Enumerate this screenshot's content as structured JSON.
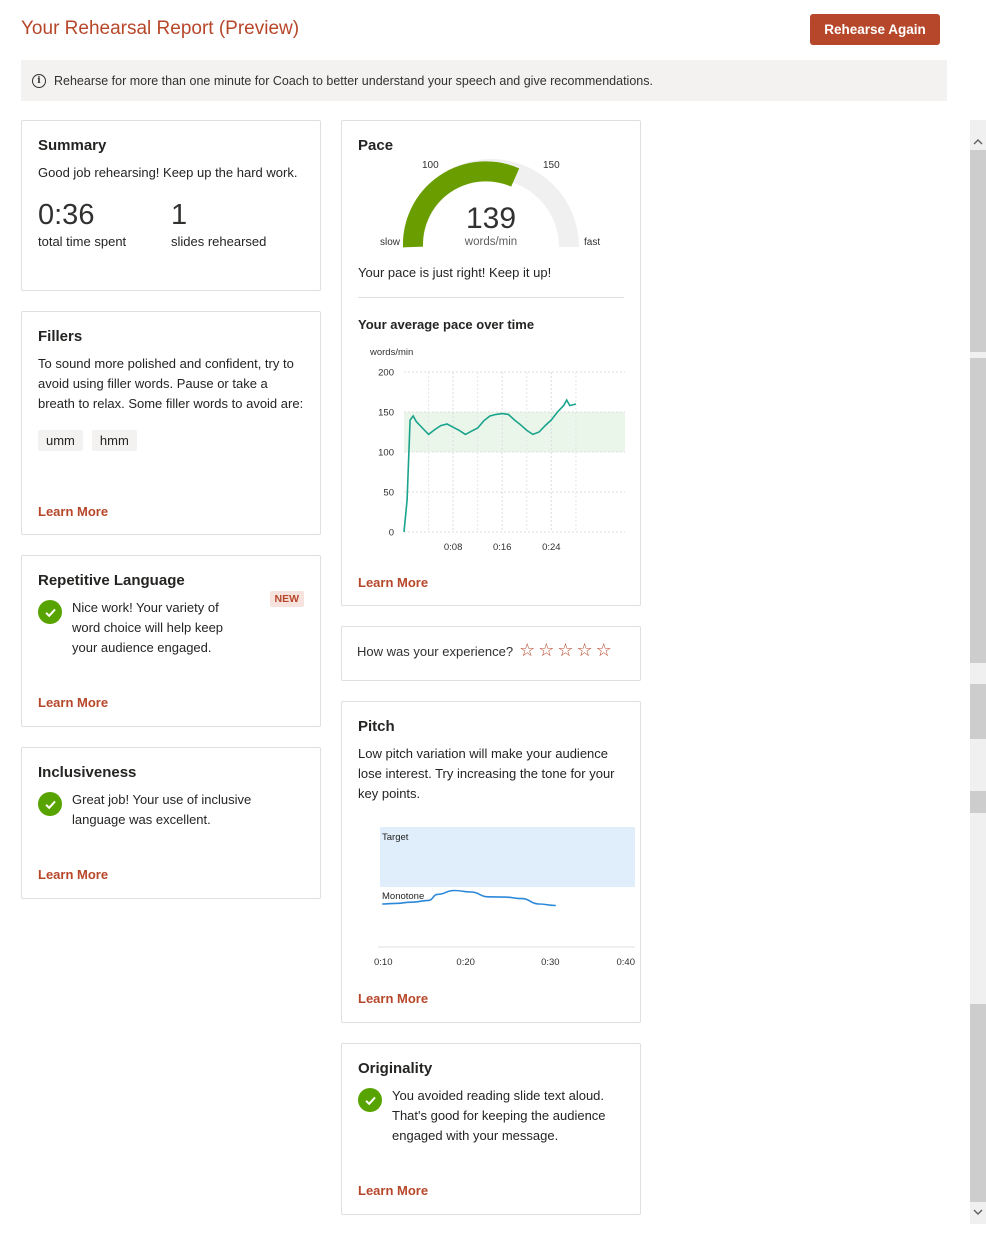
{
  "header": {
    "title": "Your Rehearsal Report (Preview)",
    "rehearse_button": "Rehearse Again"
  },
  "info_bar": {
    "icon": "info-icon",
    "text": "Rehearse for more than one minute for Coach to better understand your speech and give recommendations."
  },
  "summary": {
    "title": "Summary",
    "text": "Good job rehearsing! Keep up the hard work.",
    "time_value": "0:36",
    "time_label": "total time spent",
    "slides_value": "1",
    "slides_label": "slides rehearsed"
  },
  "fillers": {
    "title": "Fillers",
    "text": "To sound more polished and confident, try to avoid using filler words. Pause or take a breath to relax. Some filler words to avoid are:",
    "words": [
      "umm",
      "hmm"
    ],
    "learn_more": "Learn More"
  },
  "repetitive": {
    "title": "Repetitive Language",
    "badge": "NEW",
    "text": "Nice work! Your variety of word choice will help keep your audience engaged.",
    "learn_more": "Learn More"
  },
  "inclusiveness": {
    "title": "Inclusiveness",
    "text": "Great job! Your use of inclusive language was excellent.",
    "learn_more": "Learn More"
  },
  "pace": {
    "title": "Pace",
    "gauge": {
      "value": "139",
      "unit": "words/min",
      "label_100": "100",
      "label_150": "150",
      "slow": "slow",
      "fast": "fast"
    },
    "message": "Your pace is just right! Keep it up!",
    "over_time_title": "Your average pace over time",
    "learn_more": "Learn More"
  },
  "rating": {
    "question": "How was your experience?",
    "stars": 5,
    "star_glyph": "☆"
  },
  "pitch": {
    "title": "Pitch",
    "text": "Low pitch variation will make your audience lose interest. Try increasing the tone for your key points.",
    "target_label": "Target",
    "monotone_label": "Monotone",
    "x_ticks": [
      "0:10",
      "0:20",
      "0:30",
      "0:40"
    ],
    "learn_more": "Learn More"
  },
  "originality": {
    "title": "Originality",
    "text": "You avoided reading slide text aloud. That's good for keeping the audience engaged with your message.",
    "learn_more": "Learn More"
  },
  "chart_data": [
    {
      "type": "line",
      "title": "Your average pace over time",
      "ylabel": "words/min",
      "xlabel": "",
      "ylim": [
        0,
        200
      ],
      "y_ticks": [
        0,
        50,
        100,
        150,
        200
      ],
      "x_ticks": [
        "0:08",
        "0:16",
        "0:24"
      ],
      "xlim_seconds": [
        0,
        36
      ],
      "target_band": [
        100,
        150
      ],
      "grid": true,
      "series": [
        {
          "color": "#1aa38c",
          "x_seconds": [
            0,
            0.5,
            1,
            1.5,
            2,
            3,
            4,
            5,
            6,
            7,
            8,
            9,
            10,
            11,
            12,
            13,
            14,
            15,
            16,
            17,
            18,
            19,
            20,
            21,
            22,
            23,
            24,
            25,
            26,
            26.5,
            27,
            28
          ],
          "values": [
            0,
            40,
            140,
            145,
            138,
            130,
            122,
            128,
            133,
            135,
            131,
            127,
            122,
            126,
            130,
            139,
            145,
            147,
            148,
            147,
            140,
            134,
            127,
            122,
            125,
            133,
            140,
            150,
            158,
            165,
            158,
            160
          ]
        }
      ]
    },
    {
      "type": "line",
      "title": "",
      "x_ticks": [
        "0:10",
        "0:20",
        "0:30",
        "0:40"
      ],
      "xlim_seconds": [
        10,
        40
      ],
      "bands": [
        "Target",
        "Monotone"
      ],
      "series": [
        {
          "color": "#2b88d8",
          "x_seconds": [
            10.5,
            12,
            14,
            16,
            17,
            19,
            21,
            23,
            25,
            27,
            29,
            31
          ],
          "level": [
            0.1,
            0.12,
            0.16,
            0.22,
            0.42,
            0.55,
            0.5,
            0.34,
            0.33,
            0.28,
            0.1,
            0.05
          ]
        }
      ]
    }
  ]
}
